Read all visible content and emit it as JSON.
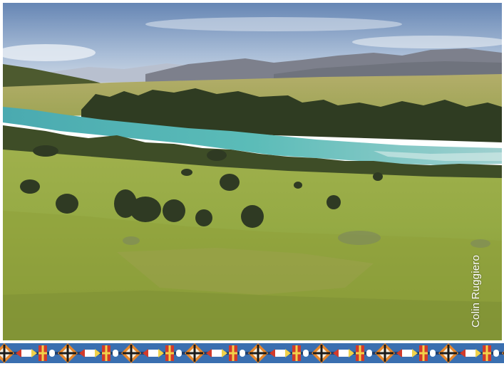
{
  "photo": {
    "description_alt": "",
    "credit": "Colin Ruggiero"
  },
  "palette": {
    "sky_top": "#6f8fb8",
    "sky_bottom": "#c9d6e6",
    "mountain_far": "#8e96aa",
    "mountain_near": "#6b6f79",
    "river": "#56b7b4",
    "grass_light": "#a9b957",
    "grass_mid": "#8fa43f",
    "grass_dark": "#6f8230",
    "tree_dark": "#2f3a23",
    "border_blue": "#3a6fb0",
    "border_orange": "#e8872a",
    "border_red": "#d23a2a",
    "border_yellow": "#f1d24a"
  },
  "decorative_border": {
    "pattern": "native-beadwork"
  }
}
